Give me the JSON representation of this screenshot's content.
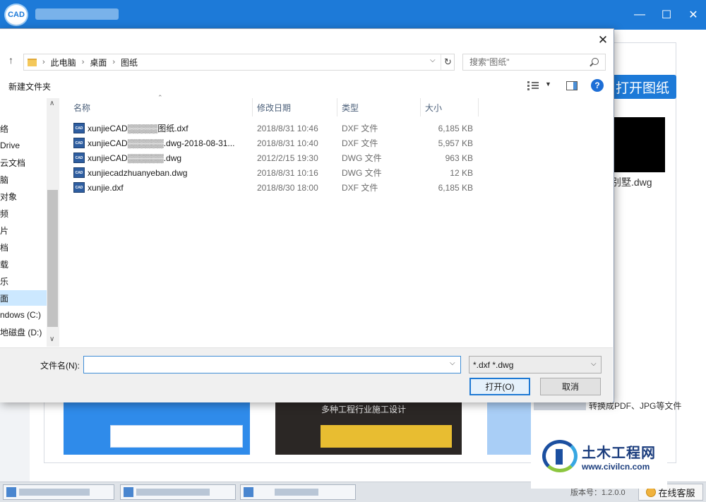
{
  "app": {
    "logo_text": "CAD",
    "window_controls": {
      "minimize": "—",
      "maximize": "☐",
      "close": "✕"
    },
    "open_drawing_label": "打开图纸",
    "thumbnail_name": "别墅.dwg",
    "promo_text_2": "多种工程行业施工设计",
    "promo_text_3": "转换成PDF、JPG等文件",
    "version_label": "版本号：1.2.0.0",
    "support_label": "在线客服"
  },
  "watermark": {
    "name": "土木工程网",
    "url": "www.civilcn.com"
  },
  "dialog": {
    "close_glyph": "✕",
    "address": {
      "segments": [
        "此电脑",
        "桌面",
        "图纸"
      ]
    },
    "search": {
      "placeholder": "搜索\"图纸\""
    },
    "toolbar": {
      "new_folder": "新建文件夹",
      "help_glyph": "?"
    },
    "nav": {
      "items": [
        "络",
        "Drive",
        "云文档",
        "脑",
        "对象",
        "频",
        "片",
        "档",
        "载",
        "乐",
        "面",
        "ndows (C:)",
        "地磁盘 (D:)"
      ],
      "selected_index": 10
    },
    "columns": {
      "name": "名称",
      "date": "修改日期",
      "type": "类型",
      "size": "大小"
    },
    "files": [
      {
        "name": "xunjieCAD▒▒▒▒▒图纸.dxf",
        "date": "2018/8/31 10:46",
        "type": "DXF 文件",
        "size": "6,185 KB"
      },
      {
        "name": "xunjieCAD▒▒▒▒▒▒.dwg-2018-08-31...",
        "date": "2018/8/31 10:40",
        "type": "DXF 文件",
        "size": "5,957 KB"
      },
      {
        "name": "xunjieCAD▒▒▒▒▒▒.dwg",
        "date": "2012/2/15 19:30",
        "type": "DWG 文件",
        "size": "963 KB"
      },
      {
        "name": "xunjiecadzhuanyeban.dwg",
        "date": "2018/8/31 10:16",
        "type": "DWG 文件",
        "size": "12 KB"
      },
      {
        "name": "xunjie.dxf",
        "date": "2018/8/30 18:00",
        "type": "DXF 文件",
        "size": "6,185 KB"
      }
    ],
    "file_icon_text": "CAD",
    "filename_label": "文件名(N):",
    "filename_value": "",
    "filetype_value": "*.dxf *.dwg",
    "open_button": "打开(O)",
    "cancel_button": "取消"
  },
  "colors": {
    "accent": "#1d7ad8",
    "selection": "#cce8ff",
    "file_icon": "#2e5ea1"
  }
}
